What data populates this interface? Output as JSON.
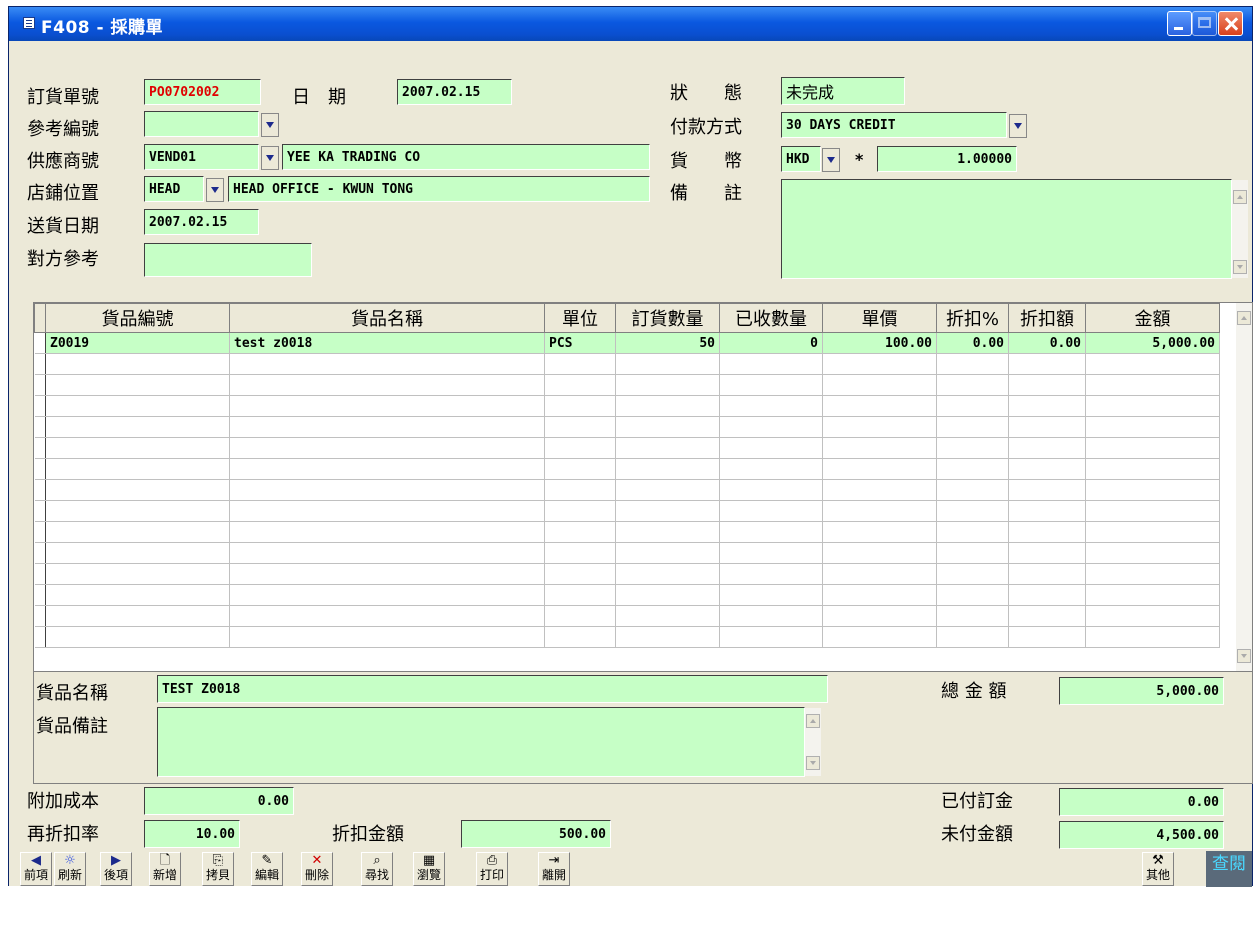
{
  "window": {
    "title": "F408 - 採購單"
  },
  "header": {
    "order_no_label": "訂貨單號",
    "order_no": "PO0702002",
    "date_label": "日　期",
    "date": "2007.02.15",
    "status_label": "狀　　態",
    "status": "未完成",
    "ref_no_label": "參考編號",
    "ref_no": "",
    "payment_label": "付款方式",
    "payment": "30 DAYS CREDIT",
    "vendor_label": "供應商號",
    "vendor_code": "VEND01",
    "vendor_name": "YEE KA TRADING CO",
    "currency_label": "貨　　幣",
    "currency": "HKD",
    "rate_sep": "*",
    "rate": "1.00000",
    "shop_label": "店鋪位置",
    "shop_code": "HEAD",
    "shop_name": "HEAD OFFICE - KWUN TONG",
    "remark_label": "備　　註",
    "remark": "",
    "delivery_label": "送貨日期",
    "delivery_date": "2007.02.15",
    "counter_ref_label": "對方參考",
    "counter_ref": ""
  },
  "grid": {
    "columns": [
      "貨品編號",
      "貨品名稱",
      "單位",
      "訂貨數量",
      "已收數量",
      "單價",
      "折扣%",
      "折扣額",
      "金額"
    ],
    "rows": [
      [
        "Z0019",
        "test z0018",
        "PCS",
        "50",
        "0",
        "100.00",
        "0.00",
        "0.00",
        "5,000.00"
      ]
    ]
  },
  "detail": {
    "item_name_label": "貨品名稱",
    "item_name": "TEST Z0018",
    "item_remark_label": "貨品備註",
    "item_remark": "",
    "total_label": "總 金 額",
    "total": "5,000.00",
    "extra_cost_label": "附加成本",
    "extra_cost": "0.00",
    "deposit_label": "已付訂金",
    "deposit": "0.00",
    "rediscount_label": "再折扣率",
    "rediscount": "10.00",
    "discount_amt_label": "折扣金額",
    "discount_amt": "500.00",
    "unpaid_label": "未付金額",
    "unpaid": "4,500.00"
  },
  "toolbar": {
    "prev": "前項",
    "refresh": "刷新",
    "next": "後項",
    "new": "新增",
    "copy": "拷貝",
    "edit": "編輯",
    "delete": "刪除",
    "find": "尋找",
    "browse": "瀏覽",
    "print": "打印",
    "exit": "離開",
    "other": "其他",
    "mode": "查閱"
  }
}
